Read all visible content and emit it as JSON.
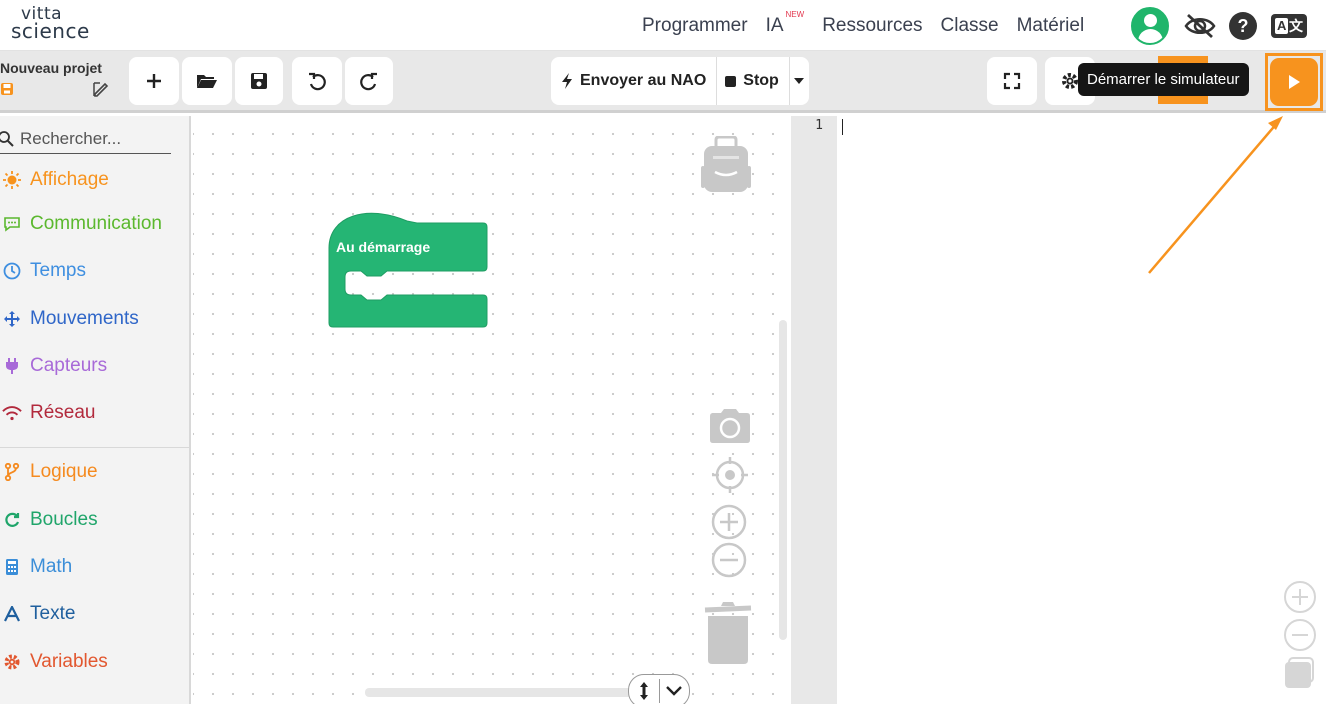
{
  "brand": {
    "line1": "vitta",
    "line2": "science"
  },
  "nav": {
    "links": [
      {
        "label": "Programmer"
      },
      {
        "label": "IA",
        "badge": "NEW"
      },
      {
        "label": "Ressources"
      },
      {
        "label": "Classe"
      },
      {
        "label": "Matériel"
      }
    ],
    "icons": [
      "user-avatar-icon",
      "eye-off-icon",
      "help-icon",
      "translate-icon"
    ],
    "help_label": "?",
    "lang_label_a": "A",
    "lang_label_b": "文"
  },
  "project": {
    "name": "Nouveau projet"
  },
  "toolbar": {
    "send_label": "Envoyer au NAO",
    "stop_label": "Stop",
    "tooltip": "Démarrer le simulateur"
  },
  "sidebar": {
    "search_placeholder": "Rechercher...",
    "categories": [
      {
        "label": "Affichage",
        "color": "#f7931e",
        "icon": "sun-icon"
      },
      {
        "label": "Communication",
        "color": "#5bb82e",
        "icon": "chat-icon"
      },
      {
        "label": "Temps",
        "color": "#3f8fe0",
        "icon": "clock-icon"
      },
      {
        "label": "Mouvements",
        "color": "#2f66c8",
        "icon": "arrows-move-icon"
      },
      {
        "label": "Capteurs",
        "color": "#a86ad8",
        "icon": "plug-icon"
      },
      {
        "label": "Réseau",
        "color": "#b2293c",
        "icon": "wifi-icon"
      },
      {
        "label": "Logique",
        "color": "#f58a1f",
        "icon": "branch-icon"
      },
      {
        "label": "Boucles",
        "color": "#1fa56a",
        "icon": "loop-icon"
      },
      {
        "label": "Math",
        "color": "#3b8ed8",
        "icon": "calculator-icon"
      },
      {
        "label": "Texte",
        "color": "#1f5f9e",
        "icon": "text-icon"
      },
      {
        "label": "Variables",
        "color": "#e2572f",
        "icon": "gear-icon"
      }
    ]
  },
  "workspace": {
    "block_label": "Au démarrage",
    "block_color": "#25b574"
  },
  "editor": {
    "line_number": "1"
  },
  "colors": {
    "accent": "#f7931e",
    "green": "#25b574"
  }
}
